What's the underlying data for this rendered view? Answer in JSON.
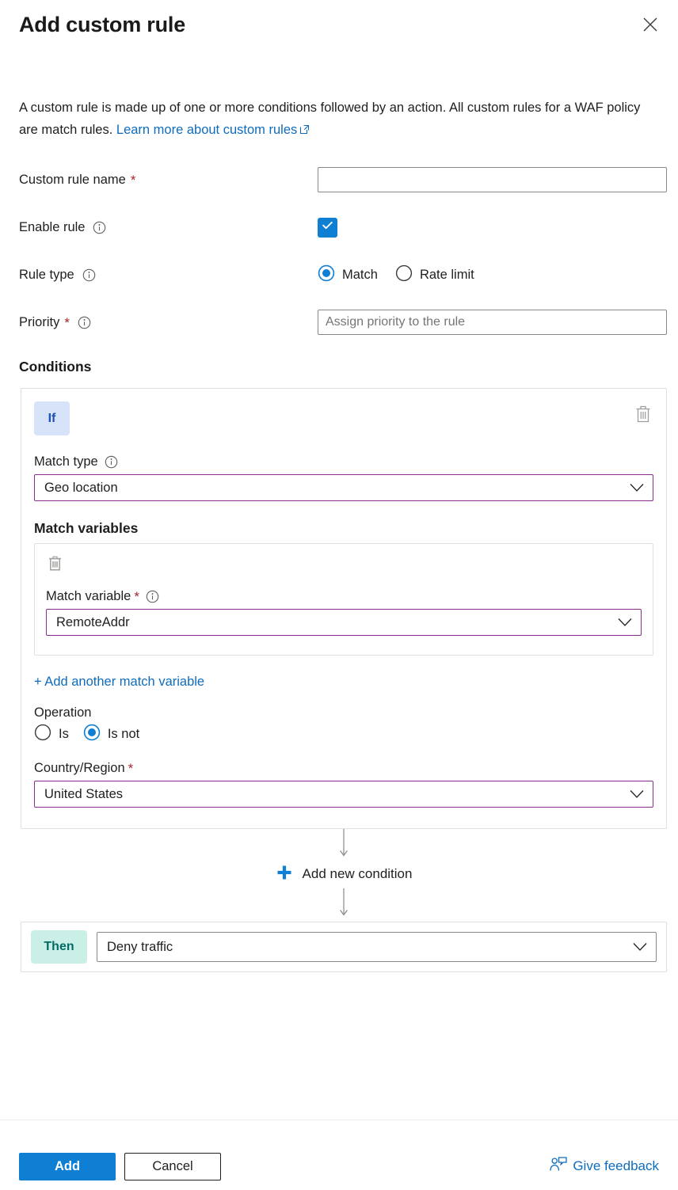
{
  "dialog": {
    "title": "Add custom rule",
    "close_icon": "close-icon",
    "intro_part1": "A custom rule is made up of one or more conditions followed by an action. All custom rules for a WAF policy are match rules.",
    "intro_link": "Learn more about custom rules",
    "intro_link_icon": "external-link-icon"
  },
  "form": {
    "custom_rule_name": {
      "label": "Custom rule name",
      "required": "*",
      "value": "",
      "placeholder": ""
    },
    "enable_rule": {
      "label": "Enable rule",
      "info_icon": "info-icon",
      "checked": true,
      "check_icon": "checkmark-icon"
    },
    "rule_type": {
      "label": "Rule type",
      "info_icon": "info-icon",
      "selected": "Match",
      "options": [
        "Match",
        "Rate limit"
      ]
    },
    "priority": {
      "label": "Priority",
      "required": "*",
      "info_icon": "info-icon",
      "value": "",
      "placeholder": "Assign priority to the rule"
    }
  },
  "conditions": {
    "heading": "Conditions",
    "if_badge": "If",
    "delete_icon": "trash-icon",
    "match_type": {
      "label": "Match type",
      "info_icon": "info-icon",
      "value": "Geo location",
      "chevron_icon": "chevron-down-icon"
    },
    "match_variables": {
      "heading": "Match variables",
      "delete_icon": "trash-icon",
      "variable": {
        "label": "Match variable",
        "required": "*",
        "info_icon": "info-icon",
        "value": "RemoteAddr",
        "chevron_icon": "chevron-down-icon"
      },
      "add_link": "+ Add another match variable"
    },
    "operation": {
      "label": "Operation",
      "selected": "Is not",
      "options": [
        "Is",
        "Is not"
      ]
    },
    "country_region": {
      "label": "Country/Region",
      "required": "*",
      "value": "United States",
      "chevron_icon": "chevron-down-icon"
    },
    "add_condition": {
      "label": "Add new condition",
      "plus_icon": "plus-icon",
      "arrow_icon": "arrow-down-icon"
    }
  },
  "action": {
    "then_badge": "Then",
    "value": "Deny traffic",
    "chevron_icon": "chevron-down-icon"
  },
  "footer": {
    "add_label": "Add",
    "cancel_label": "Cancel",
    "feedback_label": "Give feedback",
    "feedback_icon": "person-feedback-icon"
  },
  "colors": {
    "accent_blue": "#0f7fd4",
    "link_blue": "#0f6cbd",
    "required_red": "#a4262c",
    "dropdown_purple": "#8a2d91",
    "if_badge_bg": "#d6e3f8",
    "if_badge_text": "#1f50b5",
    "then_badge_bg": "#c9efe7",
    "then_badge_text": "#046b66",
    "icon_gray": "#a19f9d",
    "border_gray": "#8a8886"
  }
}
